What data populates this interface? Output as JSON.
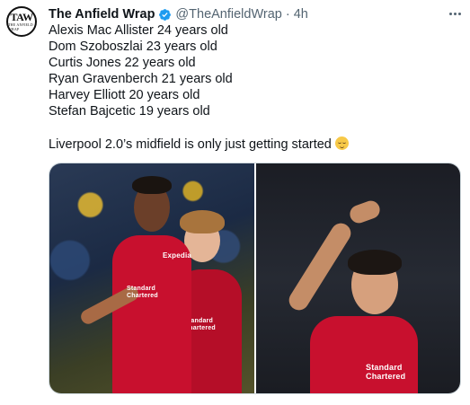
{
  "tweet": {
    "author_name": "The Anfield Wrap",
    "handle": "@TheAnfieldWrap",
    "separator": "·",
    "time": "4h",
    "avatar_monogram": "TAW",
    "avatar_subtext": "THE ANFIELD WRAP",
    "lines": [
      "Alexis Mac Allister 24 years old",
      "Dom Szoboszlai 23 years old",
      "Curtis Jones 22 years old",
      "Ryan Gravenberch 21 years old",
      "Harvey Elliott 20 years old",
      "Stefan Bajcetic 19 years old"
    ],
    "closing": "Liverpool 2.0’s midfield is only just getting started",
    "closing_emoji": "relieved-face-emoji",
    "photo_sponsor_left_1": "Expedia",
    "photo_sponsor_left_2": "Standard Chartered",
    "photo_sponsor_right": "Standard Chartered",
    "icons": {
      "verified": "verified-badge-icon",
      "more": "more-options-icon"
    },
    "colors": {
      "verified": "#1d9bf0",
      "secondary_text": "#536471",
      "kit_red": "#c8102e"
    }
  }
}
